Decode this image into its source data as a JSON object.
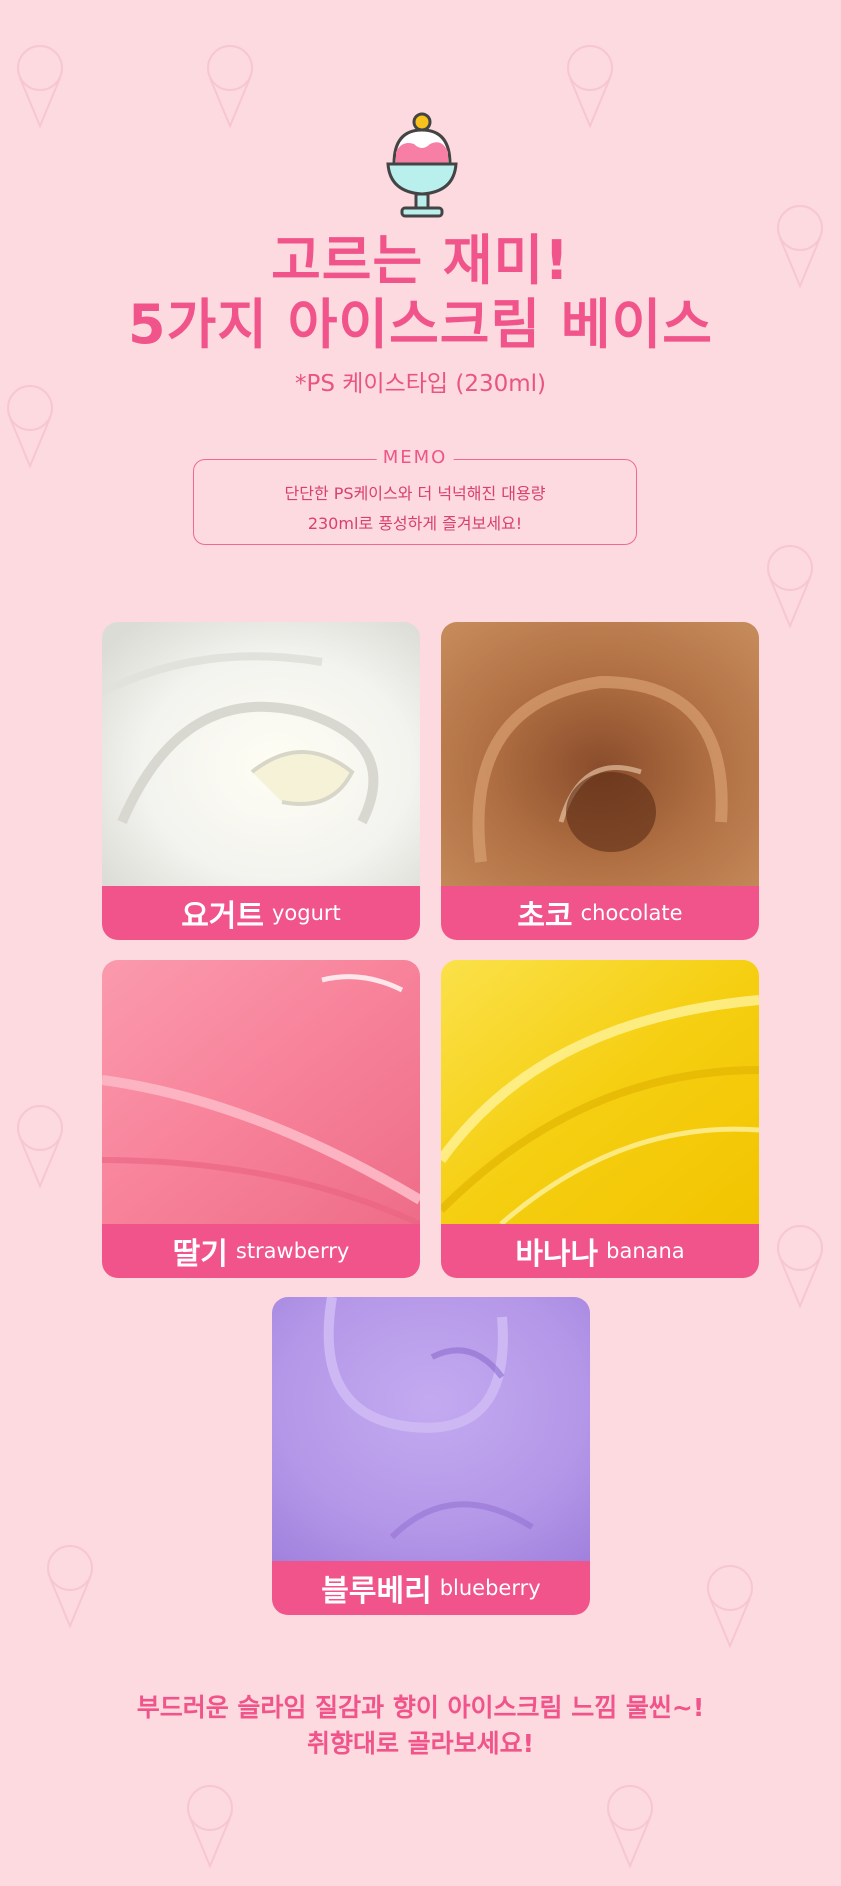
{
  "colors": {
    "background": "#fcdadf",
    "accent": "#f0548a",
    "memo_border": "#ee6a92"
  },
  "header": {
    "icon": "ice-cream-sundae-icon",
    "title_line1": "고르는 재미!",
    "title_line2": "5가지 아이스크림 베이스",
    "subtitle": "*PS 케이스타입 (230ml)"
  },
  "memo": {
    "title": "MEMO",
    "line1": "단단한 PS케이스와 더 넉넉해진 대용량",
    "line2": "230ml로 풍성하게 즐겨보세요!"
  },
  "flavors": [
    {
      "name_ko": "요거트",
      "name_en": "yogurt",
      "color": "#f6f6f3"
    },
    {
      "name_ko": "초코",
      "name_en": "chocolate",
      "color": "#a8663a"
    },
    {
      "name_ko": "딸기",
      "name_en": "strawberry",
      "color": "#f8879d"
    },
    {
      "name_ko": "바나나",
      "name_en": "banana",
      "color": "#f6d21c"
    },
    {
      "name_ko": "블루베리",
      "name_en": "blueberry",
      "color": "#b59ae6"
    }
  ],
  "footer": {
    "line1": "부드러운 슬라임 질감과 향이 아이스크림 느낌 물씬~!",
    "line2": "취향대로 골라보세요!"
  }
}
